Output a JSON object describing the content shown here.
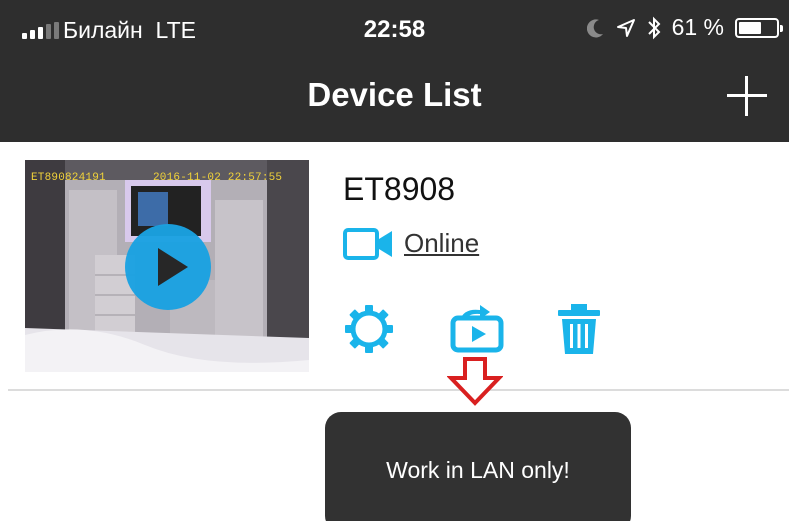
{
  "status_bar": {
    "carrier": "Билайн",
    "network": "LTE",
    "time": "22:58",
    "battery": "61 %",
    "battery_level": 0.61
  },
  "nav": {
    "title": "Device List"
  },
  "device": {
    "osd_id": "ET890824191",
    "osd_timestamp": "2016-11-02 22:57:55",
    "name": "ET8908",
    "status": "Online"
  },
  "toast": {
    "message": "Work in LAN only!"
  },
  "colors": {
    "topbar": "#2e2e2e",
    "accent": "#1ab4ea",
    "annotation_arrow": "#d92020",
    "toast_bg": "#323232"
  },
  "icons": [
    "signal-icon",
    "moon-icon",
    "location-arrow-icon",
    "bluetooth-icon",
    "battery-icon",
    "plus-icon",
    "camera-icon",
    "gear-icon",
    "share-icon",
    "trash-icon",
    "arrow-down-icon",
    "play-icon"
  ]
}
